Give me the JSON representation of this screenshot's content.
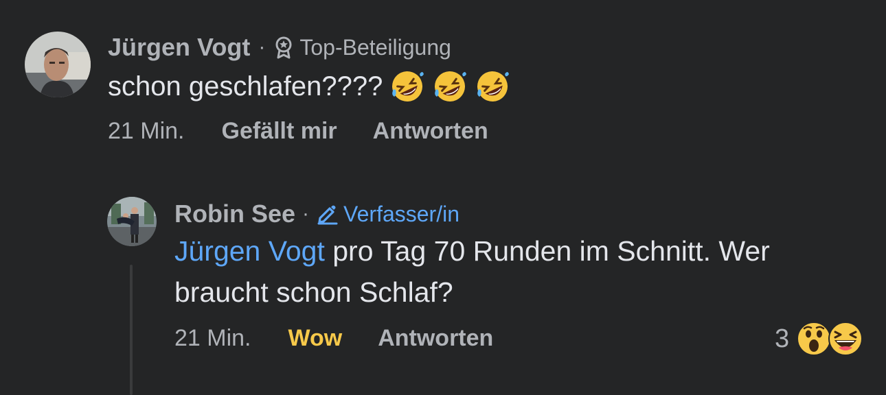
{
  "comments": [
    {
      "author": "Jürgen Vogt",
      "separator": "·",
      "badge": "Top-Beteiligung",
      "badge_icon": "top-contributor-badge-icon",
      "text": "schon geschlafen????",
      "emojis": [
        "rolling-on-floor-laughing-emoji",
        "rolling-on-floor-laughing-emoji",
        "rolling-on-floor-laughing-emoji"
      ],
      "time": "21 Min.",
      "like_label": "Gefällt mir",
      "reply_label": "Antworten"
    },
    {
      "author": "Robin See",
      "separator": "·",
      "badge": "Verfasser/in",
      "badge_icon": "pencil-icon",
      "mention": "Jürgen Vogt",
      "text": " pro Tag 70 Runden im Schnitt. Wer braucht schon Schlaf?",
      "time": "21 Min.",
      "reaction_label": "Wow",
      "reply_label": "Antworten",
      "reaction_count": "3",
      "reaction_emojis": [
        "wow-emoji",
        "haha-emoji"
      ]
    }
  ],
  "colors": {
    "background": "#242526",
    "secondary_text": "#b0b3b8",
    "primary_text": "#e4e6eb",
    "link_blue": "#5ea7f8",
    "wow_yellow": "#f7c94a"
  }
}
